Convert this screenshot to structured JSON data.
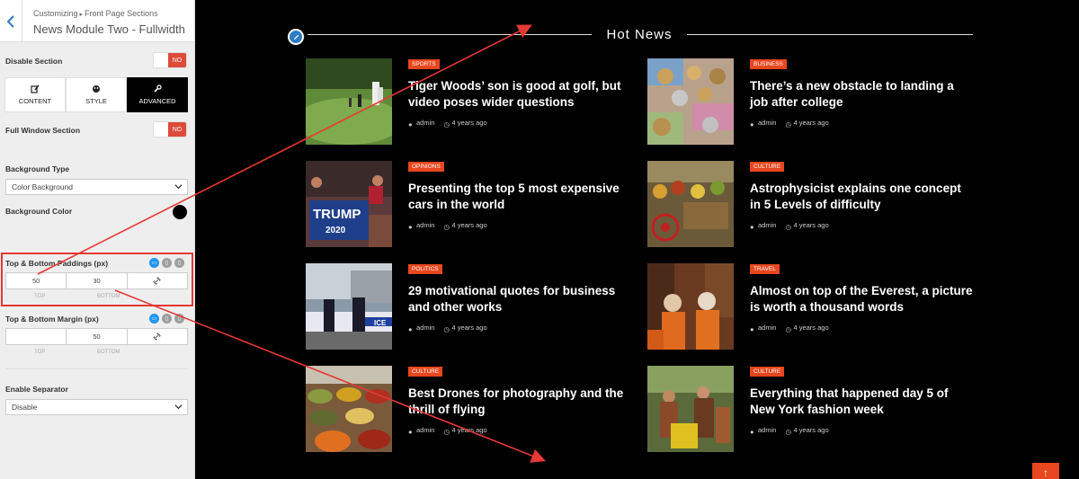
{
  "panel": {
    "breadcrumb": [
      "Customizing",
      "Front Page Sections"
    ],
    "section_title": "News Module Two - Fullwidth",
    "disable_section": {
      "label": "Disable Section",
      "value": "NO"
    },
    "tabs": [
      {
        "label": "CONTENT",
        "icon": "edit-icon",
        "active": false
      },
      {
        "label": "STYLE",
        "icon": "palette-icon",
        "active": false
      },
      {
        "label": "ADVANCED",
        "icon": "wrench-icon",
        "active": true
      }
    ],
    "full_window": {
      "label": "Full Window Section",
      "value": "NO"
    },
    "background_type": {
      "label": "Background Type",
      "value": "Color Background"
    },
    "background_color": {
      "label": "Background Color",
      "value": "#000000"
    },
    "paddings": {
      "label": "Top & Bottom Paddings (px)",
      "top": "50",
      "bottom": "30",
      "top_label": "TOP",
      "bottom_label": "BOTTOM"
    },
    "margin": {
      "label": "Top & Bottom Margin (px)",
      "top": "",
      "bottom": "50",
      "top_label": "TOP",
      "bottom_label": "BOTTOM"
    },
    "separator": {
      "label": "Enable Separator",
      "value": "Disable"
    }
  },
  "preview": {
    "section_title": "Hot News",
    "accent": "#e8461e",
    "articles": [
      {
        "category": "SPORTS",
        "title": "Tiger Woods’ son is good at golf, but video poses wider questions",
        "author": "admin",
        "time": "4 years ago"
      },
      {
        "category": "BUSINESS",
        "title": "There’s a new obstacle to landing a job after college",
        "author": "admin",
        "time": "4 years ago"
      },
      {
        "category": "OPINIONS",
        "title": "Presenting the top 5 most expensive cars in the world",
        "author": "admin",
        "time": "4 years ago"
      },
      {
        "category": "CULTURE",
        "title": "Astrophysicist explains one concept in 5 Levels of difficulty",
        "author": "admin",
        "time": "4 years ago"
      },
      {
        "category": "POLITICS",
        "title": "29 motivational quotes for business and other works",
        "author": "admin",
        "time": "4 years ago"
      },
      {
        "category": "TRAVEL",
        "title": "Almost on top of the Everest, a picture is worth a thousand words",
        "author": "admin",
        "time": "4 years ago"
      },
      {
        "category": "CULTURE",
        "title": "Best Drones for photography and the thrill of flying",
        "author": "admin",
        "time": "4 years ago"
      },
      {
        "category": "CULTURE",
        "title": "Everything that happened day 5 of New York fashion week",
        "author": "admin",
        "time": "4 years ago"
      }
    ],
    "thumb_text": {
      "trump_sign_1": "TRUMP",
      "trump_sign_2": "2020",
      "police_car": "ICE"
    },
    "scroll_top_icon": "arrow-up-icon"
  }
}
